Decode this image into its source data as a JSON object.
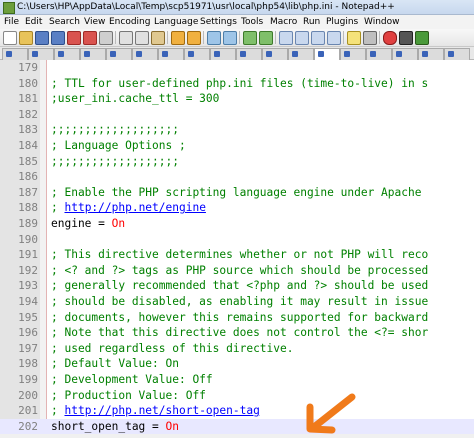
{
  "window": {
    "title": "C:\\Users\\HP\\AppData\\Local\\Temp\\scp51971\\usr\\local\\php54\\lib\\php.ini - Notepad++"
  },
  "menu": [
    "File",
    "Edit",
    "Search",
    "View",
    "Encoding",
    "Language",
    "Settings",
    "Tools",
    "Macro",
    "Run",
    "Plugins",
    "Window"
  ],
  "toolbar_icons": [
    "new-file-icon",
    "open-file-icon",
    "save-icon",
    "save-all-icon",
    "close-icon",
    "close-all-icon",
    "print-icon",
    "cut-icon",
    "copy-icon",
    "paste-icon",
    "undo-icon",
    "redo-icon",
    "find-icon",
    "replace-icon",
    "zoom-in-icon",
    "zoom-out-icon",
    "sync-scroll-icon",
    "wrap-icon",
    "show-all-chars-icon",
    "indent-guide-icon",
    "user-lang-icon",
    "doc-map-icon",
    "record-macro-icon",
    "stop-macro-icon",
    "play-macro-icon"
  ],
  "editor": {
    "lines": [
      {
        "num": "179",
        "segments": []
      },
      {
        "num": "180",
        "segments": [
          {
            "t": "; TTL for user-defined php.ini files (time-to-live) in s",
            "c": "comment"
          }
        ]
      },
      {
        "num": "181",
        "segments": [
          {
            "t": ";user_ini.cache_ttl = 300",
            "c": "comment"
          }
        ]
      },
      {
        "num": "182",
        "segments": []
      },
      {
        "num": "183",
        "segments": [
          {
            "t": ";;;;;;;;;;;;;;;;;;;",
            "c": "comment"
          }
        ]
      },
      {
        "num": "184",
        "segments": [
          {
            "t": "; Language Options ;",
            "c": "comment"
          }
        ]
      },
      {
        "num": "185",
        "segments": [
          {
            "t": ";;;;;;;;;;;;;;;;;;;",
            "c": "comment"
          }
        ]
      },
      {
        "num": "186",
        "segments": []
      },
      {
        "num": "187",
        "segments": [
          {
            "t": "; Enable the PHP scripting language engine under Apache",
            "c": "comment"
          }
        ]
      },
      {
        "num": "188",
        "segments": [
          {
            "t": "; ",
            "c": "comment"
          },
          {
            "t": "http://php.net/engine",
            "c": "link"
          }
        ]
      },
      {
        "num": "189",
        "segments": [
          {
            "t": "engine = ",
            "c": "plain"
          },
          {
            "t": "On",
            "c": "value"
          }
        ]
      },
      {
        "num": "190",
        "segments": []
      },
      {
        "num": "191",
        "segments": [
          {
            "t": "; This directive determines whether or not PHP will reco",
            "c": "comment"
          }
        ]
      },
      {
        "num": "192",
        "segments": [
          {
            "t": "; <? and ?> tags as PHP source which should be processed",
            "c": "comment"
          }
        ]
      },
      {
        "num": "193",
        "segments": [
          {
            "t": "; generally recommended that <?php and ?> should be used",
            "c": "comment"
          }
        ]
      },
      {
        "num": "194",
        "segments": [
          {
            "t": "; should be disabled, as enabling it may result in issue",
            "c": "comment"
          }
        ]
      },
      {
        "num": "195",
        "segments": [
          {
            "t": "; documents, however this remains supported for backward",
            "c": "comment"
          }
        ]
      },
      {
        "num": "196",
        "segments": [
          {
            "t": "; Note that this directive does not control the <?= shor",
            "c": "comment"
          }
        ]
      },
      {
        "num": "197",
        "segments": [
          {
            "t": "; used regardless of this directive.",
            "c": "comment"
          }
        ]
      },
      {
        "num": "198",
        "segments": [
          {
            "t": "; Default Value: On",
            "c": "comment"
          }
        ]
      },
      {
        "num": "199",
        "segments": [
          {
            "t": "; Development Value: Off",
            "c": "comment"
          }
        ]
      },
      {
        "num": "200",
        "segments": [
          {
            "t": "; Production Value: Off",
            "c": "comment"
          }
        ]
      },
      {
        "num": "201",
        "segments": [
          {
            "t": "; ",
            "c": "comment"
          },
          {
            "t": "http://php.net/short-open-tag",
            "c": "link"
          }
        ]
      },
      {
        "num": "202",
        "segments": [
          {
            "t": "short_open_tag = ",
            "c": "plain"
          },
          {
            "t": "On",
            "c": "value"
          }
        ],
        "current": true
      }
    ]
  },
  "annotation": {
    "arrow_color": "#f07a1a"
  }
}
